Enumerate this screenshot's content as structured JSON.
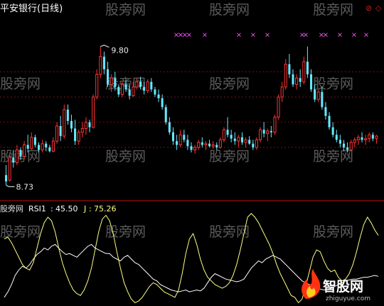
{
  "chart_data": [
    {
      "type": "candlestick",
      "title": "平安银行(日线)",
      "ylim": [
        8.6,
        10.0
      ],
      "annotations": [
        {
          "label": "9.80",
          "value": 9.8,
          "kind": "high"
        },
        {
          "label": "8.73",
          "value": 8.73,
          "kind": "low"
        }
      ],
      "signal_marker": "×",
      "signal_color": "#ff55ff",
      "colors": {
        "up": "#ff3333",
        "down": "#66e8ff"
      },
      "candles": [
        [
          8.78,
          8.86,
          8.7,
          8.73
        ],
        [
          8.74,
          8.96,
          8.73,
          8.92
        ],
        [
          8.92,
          8.98,
          8.84,
          8.88
        ],
        [
          8.88,
          9.02,
          8.86,
          8.98
        ],
        [
          8.98,
          9.0,
          8.9,
          8.93
        ],
        [
          8.93,
          9.05,
          8.91,
          9.02
        ],
        [
          9.02,
          9.1,
          8.96,
          8.99
        ],
        [
          8.99,
          9.12,
          8.98,
          9.08
        ],
        [
          9.08,
          9.1,
          9.0,
          9.02
        ],
        [
          9.02,
          9.04,
          8.96,
          8.98
        ],
        [
          8.98,
          9.06,
          8.96,
          9.03
        ],
        [
          9.03,
          9.05,
          8.97,
          9.0
        ],
        [
          9.0,
          9.02,
          8.96,
          8.97
        ],
        [
          8.97,
          9.08,
          8.96,
          9.05
        ],
        [
          9.05,
          9.2,
          9.03,
          9.17
        ],
        [
          9.17,
          9.25,
          9.05,
          9.09
        ],
        [
          9.09,
          9.34,
          9.07,
          9.3
        ],
        [
          9.3,
          9.34,
          9.18,
          9.21
        ],
        [
          9.21,
          9.26,
          9.12,
          9.15
        ],
        [
          9.15,
          9.22,
          9.02,
          9.05
        ],
        [
          9.05,
          9.14,
          9.02,
          9.12
        ],
        [
          9.12,
          9.2,
          9.08,
          9.15
        ],
        [
          9.15,
          9.24,
          9.1,
          9.2
        ],
        [
          9.2,
          9.22,
          9.12,
          9.16
        ],
        [
          9.16,
          9.42,
          9.15,
          9.4
        ],
        [
          9.4,
          9.62,
          9.38,
          9.58
        ],
        [
          9.58,
          9.8,
          9.55,
          9.72
        ],
        [
          9.72,
          9.76,
          9.58,
          9.62
        ],
        [
          9.62,
          9.68,
          9.48,
          9.5
        ],
        [
          9.5,
          9.58,
          9.44,
          9.55
        ],
        [
          9.55,
          9.6,
          9.45,
          9.48
        ],
        [
          9.48,
          9.5,
          9.4,
          9.42
        ],
        [
          9.42,
          9.52,
          9.4,
          9.5
        ],
        [
          9.5,
          9.54,
          9.44,
          9.46
        ],
        [
          9.46,
          9.5,
          9.38,
          9.41
        ],
        [
          9.41,
          9.52,
          9.4,
          9.48
        ],
        [
          9.48,
          9.55,
          9.46,
          9.52
        ],
        [
          9.52,
          9.56,
          9.46,
          9.48
        ],
        [
          9.48,
          9.52,
          9.42,
          9.45
        ],
        [
          9.45,
          9.54,
          9.43,
          9.52
        ],
        [
          9.52,
          9.55,
          9.44,
          9.46
        ],
        [
          9.46,
          9.48,
          9.4,
          9.42
        ],
        [
          9.42,
          9.46,
          9.36,
          9.39
        ],
        [
          9.39,
          9.42,
          9.3,
          9.32
        ],
        [
          9.32,
          9.34,
          9.18,
          9.2
        ],
        [
          9.2,
          9.24,
          9.1,
          9.12
        ],
        [
          9.12,
          9.16,
          9.02,
          9.05
        ],
        [
          9.05,
          9.1,
          8.98,
          9.02
        ],
        [
          9.02,
          9.14,
          9.0,
          9.1
        ],
        [
          9.1,
          9.14,
          9.04,
          9.06
        ],
        [
          9.06,
          9.1,
          8.98,
          9.01
        ],
        [
          9.01,
          9.04,
          8.96,
          8.98
        ],
        [
          8.98,
          9.02,
          8.95,
          9.0
        ],
        [
          9.0,
          9.06,
          8.98,
          9.04
        ],
        [
          9.04,
          9.08,
          9.0,
          9.02
        ],
        [
          9.02,
          9.05,
          8.98,
          9.03
        ],
        [
          9.03,
          9.06,
          9.0,
          9.01
        ],
        [
          9.01,
          9.05,
          8.99,
          9.02
        ],
        [
          9.02,
          9.04,
          8.98,
          9.0
        ],
        [
          9.0,
          9.08,
          8.99,
          9.06
        ],
        [
          9.06,
          9.16,
          9.04,
          9.14
        ],
        [
          9.14,
          9.24,
          9.08,
          9.1
        ],
        [
          9.1,
          9.14,
          9.04,
          9.07
        ],
        [
          9.07,
          9.12,
          9.02,
          9.05
        ],
        [
          9.05,
          9.1,
          9.0,
          9.08
        ],
        [
          9.08,
          9.12,
          9.02,
          9.04
        ],
        [
          9.04,
          9.08,
          9.0,
          9.06
        ],
        [
          9.06,
          9.09,
          9.02,
          9.03
        ],
        [
          9.03,
          9.06,
          8.98,
          9.0
        ],
        [
          9.0,
          9.08,
          8.98,
          9.06
        ],
        [
          9.06,
          9.16,
          9.04,
          9.14
        ],
        [
          9.14,
          9.2,
          9.08,
          9.11
        ],
        [
          9.11,
          9.15,
          9.05,
          9.13
        ],
        [
          9.13,
          9.17,
          9.08,
          9.12
        ],
        [
          9.12,
          9.26,
          9.1,
          9.24
        ],
        [
          9.24,
          9.42,
          9.22,
          9.4
        ],
        [
          9.4,
          9.52,
          9.36,
          9.48
        ],
        [
          9.48,
          9.7,
          9.46,
          9.66
        ],
        [
          9.66,
          9.74,
          9.55,
          9.58
        ],
        [
          9.58,
          9.62,
          9.48,
          9.5
        ],
        [
          9.5,
          9.58,
          9.46,
          9.55
        ],
        [
          9.55,
          9.62,
          9.48,
          9.52
        ],
        [
          9.52,
          9.72,
          9.5,
          9.68
        ],
        [
          9.68,
          9.8,
          9.55,
          9.58
        ],
        [
          9.58,
          9.62,
          9.44,
          9.46
        ],
        [
          9.46,
          9.5,
          9.36,
          9.38
        ],
        [
          9.38,
          9.46,
          9.36,
          9.44
        ],
        [
          9.44,
          9.48,
          9.3,
          9.32
        ],
        [
          9.32,
          9.36,
          9.22,
          9.25
        ],
        [
          9.25,
          9.28,
          9.14,
          9.16
        ],
        [
          9.16,
          9.2,
          9.08,
          9.1
        ],
        [
          9.1,
          9.14,
          9.04,
          9.06
        ],
        [
          9.06,
          9.1,
          9.0,
          9.03
        ],
        [
          9.03,
          9.06,
          8.97,
          9.0
        ],
        [
          9.0,
          9.04,
          8.96,
          8.98
        ],
        [
          8.98,
          9.06,
          8.97,
          9.04
        ],
        [
          9.04,
          9.08,
          9.0,
          9.06
        ],
        [
          9.06,
          9.1,
          9.02,
          9.08
        ],
        [
          9.08,
          9.12,
          9.04,
          9.06
        ],
        [
          9.06,
          9.1,
          9.02,
          9.07
        ],
        [
          9.07,
          9.12,
          9.04,
          9.1
        ],
        [
          9.1,
          9.12,
          9.05,
          9.07
        ],
        [
          9.07,
          9.1,
          9.03,
          9.09
        ]
      ]
    },
    {
      "type": "line",
      "title": "股旁网",
      "legend": [
        {
          "name": "RSI1",
          "value": "45.50",
          "color": "#ffffff"
        },
        {
          "name": "J",
          "value": "75.26",
          "color": "#ffff80"
        }
      ],
      "ylim": [
        0,
        100
      ],
      "series": [
        {
          "name": "RSI1",
          "color": "#ffffff",
          "values": [
            8,
            14,
            22,
            32,
            38,
            42,
            40,
            44,
            50,
            55,
            58,
            62,
            60,
            64,
            66,
            62,
            58,
            55,
            56,
            54,
            52,
            56,
            60,
            64,
            66,
            62,
            60,
            58,
            56,
            56,
            52,
            50,
            48,
            52,
            54,
            50,
            46,
            44,
            40,
            36,
            32,
            28,
            26,
            22,
            20,
            18,
            16,
            15,
            14,
            15,
            16,
            14,
            15,
            16,
            15,
            18,
            24,
            30,
            34,
            32,
            30,
            28,
            27,
            26,
            25,
            26,
            28,
            34,
            40,
            44,
            48,
            46,
            50,
            52,
            54,
            52,
            50,
            46,
            42,
            38,
            34,
            30,
            26,
            24,
            22,
            20,
            18,
            17,
            16,
            17,
            18,
            20,
            22,
            24,
            26,
            27,
            28,
            28,
            29,
            30,
            30,
            31,
            32,
            31
          ]
        },
        {
          "name": "J",
          "color": "#ffff80",
          "values": [
            72,
            74,
            68,
            60,
            52,
            44,
            40,
            38,
            46,
            62,
            78,
            90,
            96,
            92,
            80,
            62,
            46,
            34,
            24,
            16,
            12,
            10,
            16,
            26,
            40,
            60,
            80,
            94,
            98,
            92,
            78,
            58,
            40,
            24,
            14,
            6,
            2,
            4,
            8,
            14,
            20,
            24,
            22,
            18,
            14,
            12,
            10,
            8,
            16,
            34,
            56,
            72,
            78,
            66,
            50,
            38,
            30,
            26,
            22,
            20,
            18,
            20,
            24,
            32,
            44,
            60,
            78,
            96,
            100,
            96,
            90,
            82,
            74,
            66,
            56,
            44,
            34,
            26,
            18,
            10,
            8,
            2,
            6,
            20,
            36,
            52,
            60,
            58,
            48,
            40,
            36,
            38,
            30,
            26,
            28,
            34,
            44,
            58,
            74,
            88,
            96,
            90,
            82,
            76
          ]
        }
      ]
    }
  ],
  "watermark": {
    "text": "股旁网"
  },
  "logo": {
    "name": "智股网",
    "url": "zhiguyue.com"
  },
  "top_right_marks": [
    "⊘",
    "◇"
  ]
}
